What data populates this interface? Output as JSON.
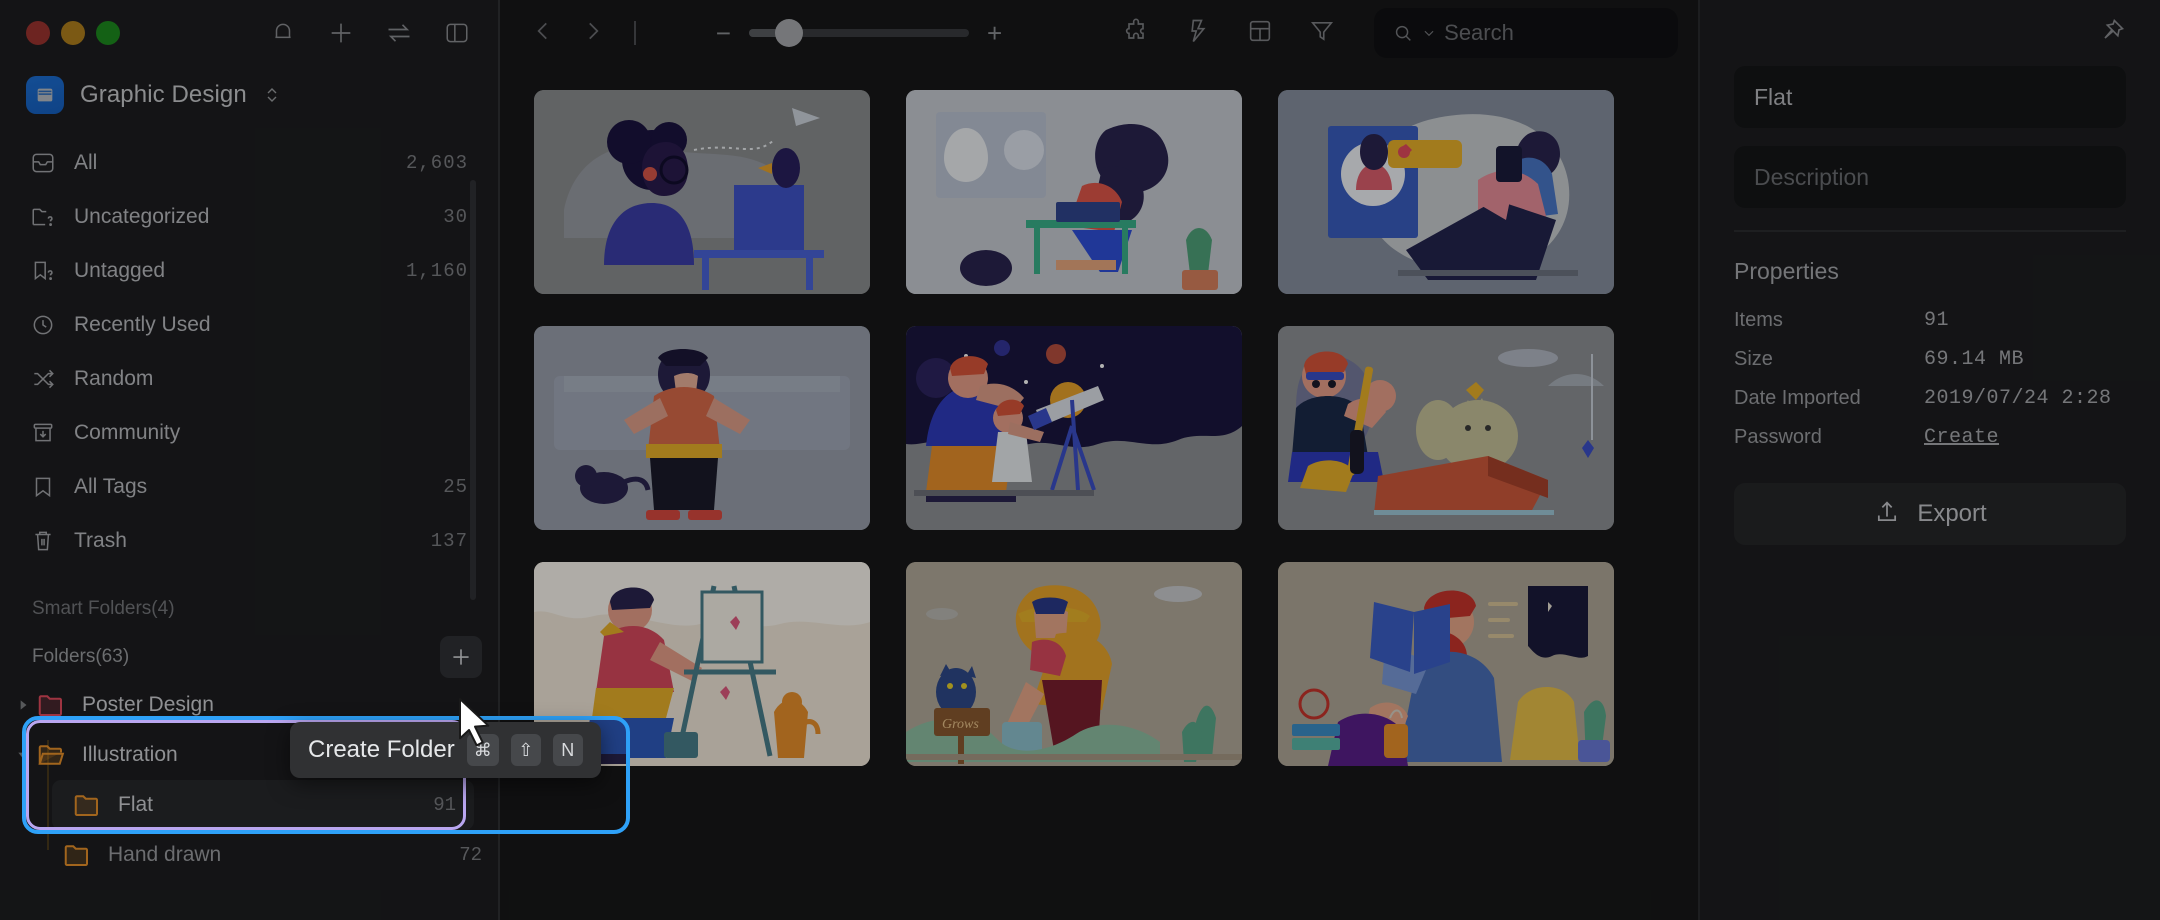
{
  "window": {
    "traffic_lights": [
      "close",
      "minimize",
      "maximize"
    ],
    "titlebar_icons": [
      "bell-icon",
      "plus-icon",
      "sync-icon",
      "sidebar-toggle-icon"
    ]
  },
  "sidebar": {
    "library": {
      "name": "Graphic Design",
      "badge_icon": "library-icon",
      "chevron_icon": "chevron-updown-icon"
    },
    "nav": [
      {
        "label": "All",
        "count": "2,603",
        "icon": "inbox-icon"
      },
      {
        "label": "Uncategorized",
        "count": "30",
        "icon": "folder-question-icon"
      },
      {
        "label": "Untagged",
        "count": "1,160",
        "icon": "tag-question-icon"
      },
      {
        "label": "Recently Used",
        "count": "",
        "icon": "clock-icon"
      },
      {
        "label": "Random",
        "count": "",
        "icon": "shuffle-icon"
      },
      {
        "label": "Community",
        "count": "",
        "icon": "community-icon"
      },
      {
        "label": "All Tags",
        "count": "25",
        "icon": "bookmark-icon"
      },
      {
        "label": "Trash",
        "count": "137",
        "icon": "trash-icon"
      }
    ],
    "smart_folders_header": "Smart Folders(4)",
    "folders_header": "Folders(63)",
    "add_folder_icon": "plus-icon",
    "folders": [
      {
        "label": "Poster Design",
        "count": "",
        "color": "#e24b5e",
        "expanded": false,
        "level": 0,
        "selected": false
      },
      {
        "label": "Illustration",
        "count": "",
        "color": "#e8912a",
        "expanded": true,
        "level": 0,
        "selected": false
      },
      {
        "label": "Flat",
        "count": "91",
        "color": "#e8912a",
        "expanded": false,
        "level": 1,
        "selected": true
      },
      {
        "label": "Hand drawn",
        "count": "72",
        "color": "#e8912a",
        "expanded": false,
        "level": 1,
        "selected": false
      }
    ],
    "tooltip": {
      "text": "Create Folder",
      "keys": [
        "⌘",
        "⇧",
        "N"
      ]
    }
  },
  "toolbar": {
    "back_icon": "chevron-left-icon",
    "forward_icon": "chevron-right-icon",
    "zoom_out_label": "−",
    "zoom_in_label": "+",
    "zoom_value": 12,
    "icons": [
      "extension-icon",
      "lightning-icon",
      "layout-icon",
      "filter-icon"
    ],
    "search": {
      "placeholder": "Search",
      "value": "",
      "icon": "search-icon",
      "dropdown_icon": "chevron-down-icon"
    }
  },
  "grid": {
    "items": [
      {
        "name": "woman-at-desk-with-bird",
        "bg": "#8c8e90"
      },
      {
        "name": "woman-working-on-laptop",
        "bg": "#c9cdd4"
      },
      {
        "name": "man-on-phone-video-call",
        "bg": "#8790a0"
      },
      {
        "name": "man-standing-with-cat",
        "bg": "#9aa0ac"
      },
      {
        "name": "father-and-child-telescope",
        "bg": "#8f9195"
      },
      {
        "name": "man-fishing-with-cat",
        "bg": "#8f9195"
      },
      {
        "name": "man-painting-at-easel",
        "bg": "#efe6d6"
      },
      {
        "name": "farmer-watering-plants",
        "bg": "#b3ab9a"
      },
      {
        "name": "man-reading-book",
        "bg": "#b0a899"
      }
    ]
  },
  "inspector": {
    "pin_icon": "pin-icon",
    "name_value": "Flat",
    "description_placeholder": "Description",
    "properties_title": "Properties",
    "properties": [
      {
        "key": "Items",
        "value": "91",
        "link": false
      },
      {
        "key": "Size",
        "value": "69.14 MB",
        "link": false
      },
      {
        "key": "Date Imported",
        "value": "2019/07/24 2:28",
        "link": false
      },
      {
        "key": "Password",
        "value": "Create",
        "link": true
      }
    ],
    "export_label": "Export",
    "export_icon": "upload-icon"
  },
  "colors": {
    "highlight_outer": "#2ea1f8",
    "highlight_inner": "#b9a6f0",
    "folder_red": "#e24b5e",
    "folder_orange": "#e8912a",
    "accent_blue": "#1d6fd4"
  }
}
